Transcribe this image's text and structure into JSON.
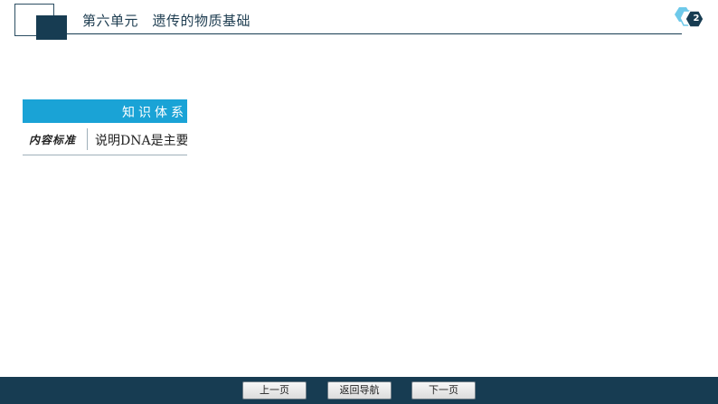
{
  "header": {
    "title": "第六单元　遗传的物质基础",
    "page_number": "2",
    "page_badge_icon": "hexagon-page-badge-icon"
  },
  "section": {
    "banner_title": "知识体系",
    "row_label": "内容标准",
    "row_content": "说明DNA是主要"
  },
  "footer": {
    "prev_label": "上一页",
    "home_label": "返回导航",
    "next_label": "下一页"
  },
  "colors": {
    "dark_navy": "#173c52",
    "accent_blue": "#1aa3d6",
    "badge_light": "#6ec9ea"
  }
}
